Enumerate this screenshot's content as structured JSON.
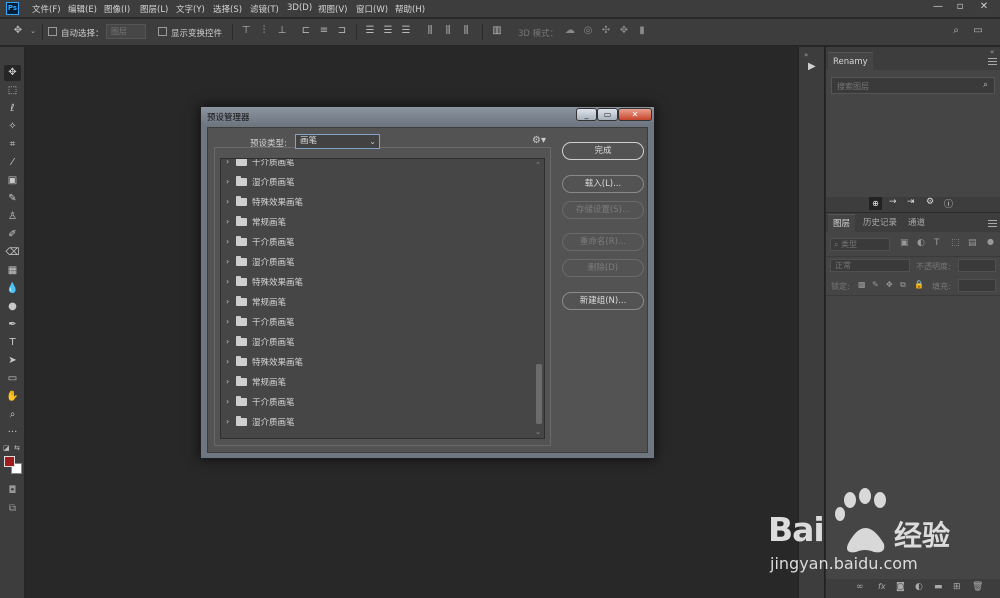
{
  "app": {
    "logo_text": "Ps",
    "menu": [
      "文件(F)",
      "编辑(E)",
      "图像(I)",
      "图层(L)",
      "文字(Y)",
      "选择(S)",
      "滤镜(T)",
      "3D(D)",
      "视图(V)",
      "窗口(W)",
      "帮助(H)"
    ],
    "window_controls": [
      "—",
      "▫",
      "✕"
    ]
  },
  "options_bar": {
    "auto_select_label": "自动选择：",
    "layer_select_value": "图层",
    "show_transform_label": "显示变换控件",
    "mode_3d_label": "3D 模式："
  },
  "dialog": {
    "title": "预设管理器",
    "preset_type_label": "预设类型:",
    "preset_type_value": "画笔",
    "presets": [
      "干介质画笔",
      "湿介质画笔",
      "特殊效果画笔",
      "常规画笔",
      "干介质画笔",
      "湿介质画笔",
      "特殊效果画笔",
      "常规画笔",
      "干介质画笔",
      "湿介质画笔",
      "特殊效果画笔",
      "常规画笔",
      "干介质画笔",
      "湿介质画笔"
    ],
    "buttons": {
      "done": "完成",
      "load": "载入(L)...",
      "save_set": "存储设置(S)...",
      "rename": "重命名(R)...",
      "delete": "删除(D)",
      "new_group": "新建组(N)..."
    }
  },
  "renamy_panel": {
    "tab": "Renamy",
    "search_placeholder": "搜索图层"
  },
  "layers_panel": {
    "tabs": [
      "图层",
      "历史记录",
      "通道"
    ],
    "filter_label": "类型",
    "blend_mode": "正常",
    "opacity_label": "不透明度:",
    "lock_label": "锁定:",
    "fill_label": "填充:"
  },
  "colors": {
    "foreground": "#a01c1c",
    "background": "#ffffff"
  },
  "watermark": {
    "brand_main": "Bai",
    "brand_accent": "经验",
    "url": "jingyan.baidu.com"
  }
}
